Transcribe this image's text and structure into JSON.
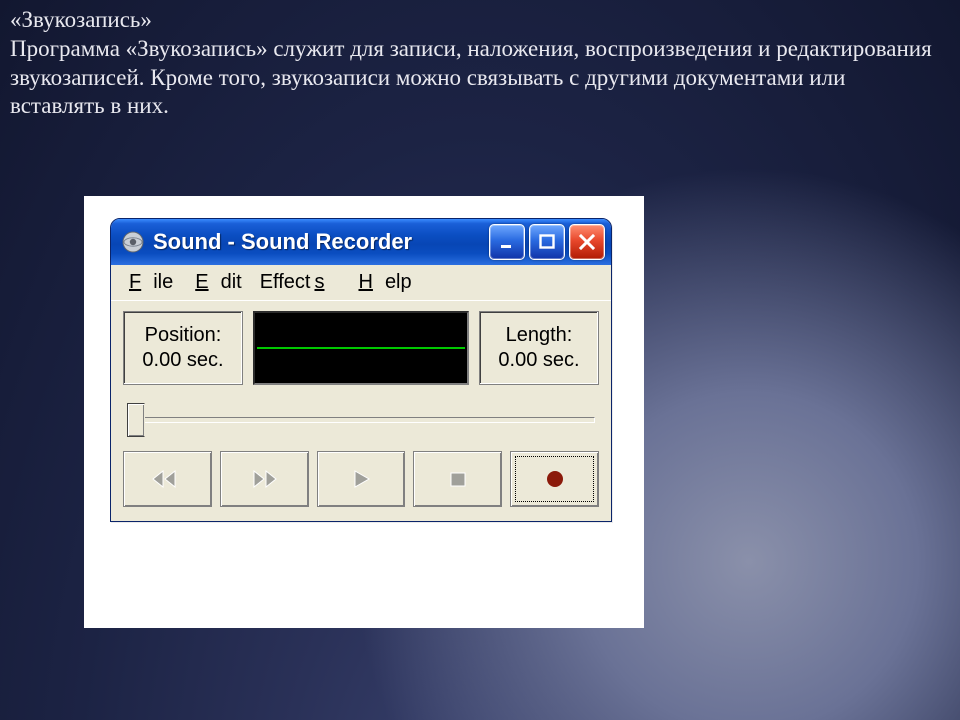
{
  "slide": {
    "title": "«Звукозапись»",
    "body": "Программа «Звукозапись» служит для записи, наложения, воспроизведения и редактирования звукозаписей. Кроме того, звукозаписи можно связывать с другими документами или вставлять в них."
  },
  "window": {
    "title": "Sound - Sound Recorder",
    "menu": {
      "file": "File",
      "edit": "Edit",
      "effects": "Effects",
      "help": "Help"
    },
    "position": {
      "label": "Position:",
      "value": "0.00 sec."
    },
    "length": {
      "label": "Length:",
      "value": "0.00 sec."
    },
    "buttons": {
      "seek_start": "seek-to-start",
      "seek_end": "seek-to-end",
      "play": "play",
      "stop": "stop",
      "record": "record"
    },
    "controls": {
      "minimize": "minimize",
      "maximize": "maximize",
      "close": "close"
    }
  }
}
